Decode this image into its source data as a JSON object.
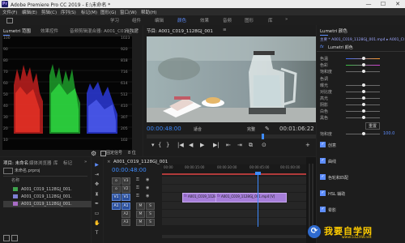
{
  "titlebar": {
    "title": "Adobe Premiere Pro CC 2019 - E:\\未命名 *",
    "app_icon": "Pr",
    "minimize": "—",
    "maximize": "☐",
    "close": "✕"
  },
  "menu": [
    "文件(F)",
    "编辑(E)",
    "剪辑(C)",
    "序列(S)",
    "标记(M)",
    "图形(G)",
    "窗口(W)",
    "帮助(H)"
  ],
  "workspaces": [
    "学习",
    "组件",
    "编辑",
    "颜色",
    "效果",
    "音频",
    "图形",
    "库"
  ],
  "workspace_more": "»",
  "scopes": {
    "tabs": [
      "Lumetri 范围",
      "效果控件",
      "音频剪辑混合器: A001_C019_1...",
      "元数据"
    ],
    "tab_more": "»",
    "menu_icon": "≡",
    "left_scale": [
      "100",
      "90",
      "80",
      "70",
      "60",
      "50",
      "40",
      "30",
      "20",
      "10"
    ],
    "right_scale": [
      "1023",
      "920",
      "818",
      "716",
      "614",
      "512",
      "410",
      "307",
      "205",
      "102"
    ],
    "clamp_label": "固定信号",
    "bit_value": "8 位"
  },
  "monitor": {
    "tab_label": "节目: A001_C019_1128GJ_001",
    "timecode": "00:00:48:00",
    "fit_option": "适合",
    "quality_option": "完整",
    "duration": "00:01:06:22"
  },
  "transport": [
    "▾",
    "{",
    "}",
    "|◀",
    "◀",
    "▶",
    "▶|",
    "⇤",
    "⇥",
    "⧉",
    "⊙",
    "+"
  ],
  "project": {
    "tabs": [
      "项目: 未命名",
      "媒体浏览器",
      "库",
      "标记"
    ],
    "tab_more": "»",
    "project_name": "未命名.prproj",
    "column_name": "名称",
    "items": [
      {
        "name": "A001_C019_1128GJ_001.",
        "color": "#3fa34d"
      },
      {
        "name": "A001_C019_1128GJ_001.",
        "color": "#7f7fd4"
      },
      {
        "name": "A001_C019_1128GJ_001.",
        "color": "#a86cc6"
      }
    ]
  },
  "timeline": {
    "tab_label": "A001_C019_1128GJ_001",
    "close_label": "×",
    "timecode": "00:00:48:00",
    "ruler": [
      "00:00",
      "00:00:15:00",
      "00:00:30:00",
      "00:00:45:00",
      "00:01:00:00"
    ],
    "tracks": [
      "V3",
      "V2",
      "V1",
      "A1",
      "A2",
      "A3"
    ],
    "track_toggle": "o",
    "track_eye": "◉",
    "track_mute": "M",
    "track_solo": "S",
    "source_video": "V1",
    "source_audio": "A1",
    "lock_icon": "⚿",
    "video_clip": "A001_C019_1128",
    "video_clip2": "A001_C019_1128GJ_001.mp4 [V]",
    "fx_badge": "fx"
  },
  "tools": [
    "▶",
    "⇥",
    "✥",
    "⧗",
    "✒",
    "▭",
    "✋",
    "T"
  ],
  "lumetri": {
    "tab_label": "Lumetri 颜色",
    "clip_label": "主要 * A001_C019_1128GJ_001.mp4 ▸ A001_C019_1128GJ_0...",
    "effect_name": "Lumetri 颜色",
    "fx_badge": "fx",
    "reset_label": "重置",
    "rows": [
      {
        "label": "色温",
        "pos": 0.5
      },
      {
        "label": "色彩",
        "pos": 0.5
      },
      {
        "label": "饱和度",
        "pos": 0.5
      },
      {
        "label": "曝光",
        "pos": 0.5
      },
      {
        "label": "对比度",
        "pos": 0.5
      },
      {
        "label": "高光",
        "pos": 0.5
      },
      {
        "label": "阴影",
        "pos": 0.5
      },
      {
        "label": "白色",
        "pos": 0.5
      },
      {
        "label": "黑色",
        "pos": 0.5
      }
    ],
    "section_tone": "色调",
    "saturation_label": "饱和度",
    "saturation_value": "100.0",
    "sections": [
      "创意",
      "曲线",
      "色轮和匹配",
      "HSL 辅助",
      "晕影"
    ]
  },
  "watermark": {
    "text": "我要自学网",
    "url": "www.51ZXW.net"
  }
}
